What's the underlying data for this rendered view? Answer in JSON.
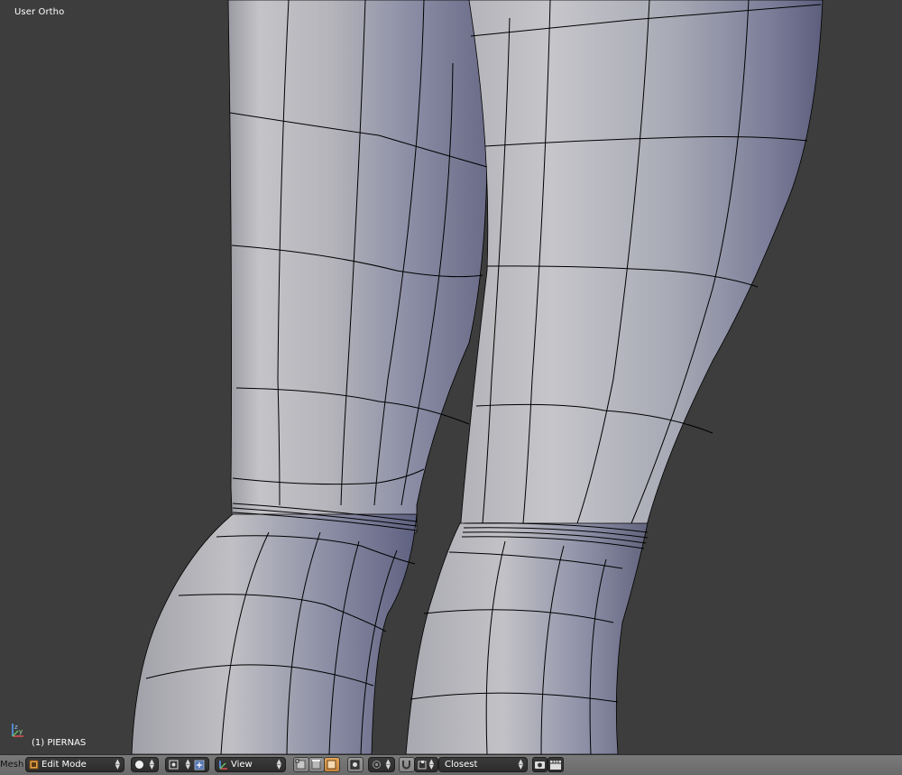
{
  "viewport": {
    "view_label": "User Ortho",
    "object_label": "(1) PIERNAS"
  },
  "header": {
    "menu_label": "Mesh",
    "mode": {
      "value": "Edit Mode",
      "icon": "edit-mode-icon"
    },
    "pivot_icon": "pivot-point-icon",
    "manipulator_icons": [
      "translate-manipulator-icon",
      "rotate-manipulator-icon"
    ],
    "orientation": {
      "value": "View",
      "icon": "transform-orientation-icon"
    },
    "select_mode_icons": [
      "vertex-select-icon",
      "edge-select-icon",
      "face-select-icon"
    ],
    "limit_selection_icon": "limit-selection-to-visible-icon",
    "proportional_icon": "proportional-editing-icon",
    "snap_icon": "snap-magnet-icon",
    "snap_element_icon": "snap-element-icon",
    "snap_target": {
      "value": "Closest"
    },
    "render_icons": [
      "opengl-render-icon",
      "opengl-animation-icon"
    ]
  },
  "colors": {
    "viewport_background": "#3d3d3d",
    "header_background": "#727272",
    "mesh_light": "#c8c8cc",
    "mesh_shadow": "#6e7090",
    "wire": "#000000"
  }
}
